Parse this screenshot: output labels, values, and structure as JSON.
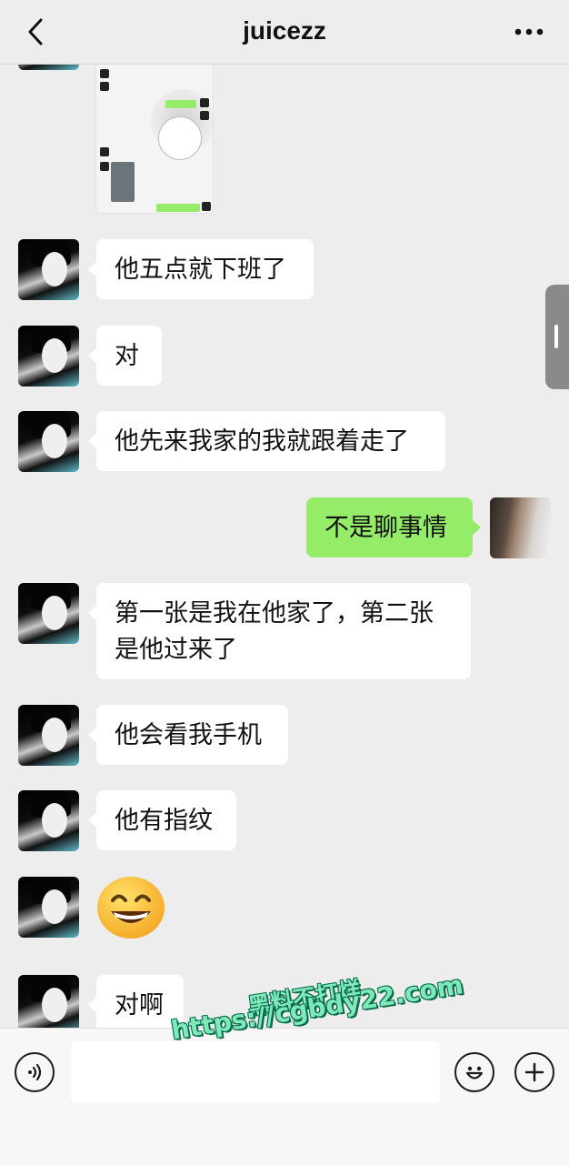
{
  "header": {
    "title": "juicezz",
    "back_icon": "chevron-left-icon",
    "more_icon": "ellipsis-icon"
  },
  "messages": [
    {
      "from": "other",
      "text": "他五点就下班了"
    },
    {
      "from": "other",
      "text": "对"
    },
    {
      "from": "other",
      "text": "他先来我家的我就跟着走了"
    },
    {
      "from": "me",
      "text": "不是聊事情"
    },
    {
      "from": "other",
      "text": "第一张是我在他家了，第二张是他过来了"
    },
    {
      "from": "other",
      "text": "他会看我手机"
    },
    {
      "from": "other",
      "text": "他有指纹"
    },
    {
      "from": "other",
      "emoji": "grinning-face-emoji"
    },
    {
      "from": "other",
      "text": "对啊"
    }
  ],
  "input_bar": {
    "voice_icon": "voice-icon",
    "emoji_icon": "smiley-icon",
    "plus_icon": "plus-icon",
    "input_value": ""
  },
  "watermark": {
    "line1": "黑料不打烊",
    "line2": "https://cgbdy22.com"
  },
  "colors": {
    "background": "#ededed",
    "my_bubble": "#95ec69",
    "their_bubble": "#ffffff"
  }
}
